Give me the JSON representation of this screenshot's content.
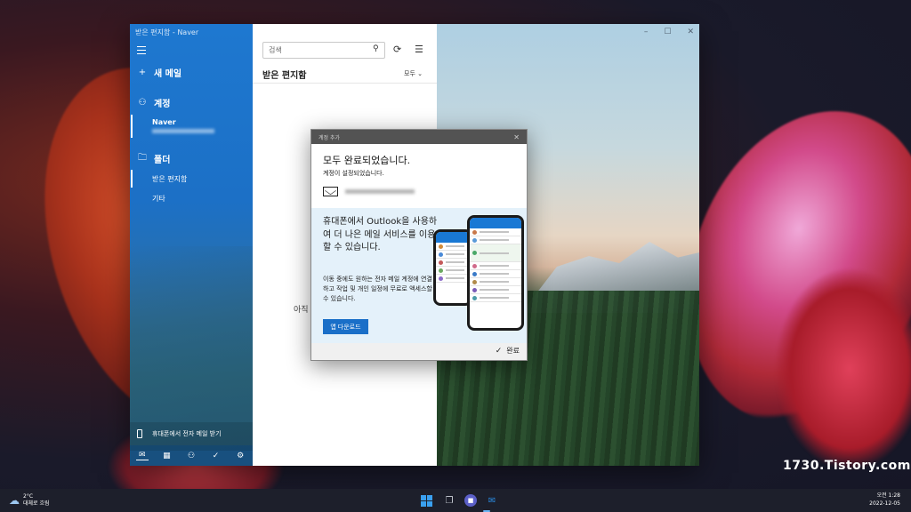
{
  "window": {
    "title": "받은 편지함 - Naver"
  },
  "sidebar": {
    "new_mail": "새 메일",
    "accounts_label": "계정",
    "account_name": "Naver",
    "folders_label": "폴더",
    "folders": [
      {
        "label": "받은 편지함"
      },
      {
        "label": "기타"
      }
    ],
    "phone_label": "휴대폰에서 전자 메일 받기"
  },
  "list": {
    "search_placeholder": "검색",
    "title": "받은 편지함",
    "filter": "모두",
    "empty_text": "아직"
  },
  "dialog": {
    "title": "계정 추가",
    "heading": "모두 완료되었습니다.",
    "subheading": "계정이 설정되었습니다.",
    "promo_heading": "휴대폰에서 Outlook을 사용하여 더 나은 메일 서비스를 이용할 수 있습니다.",
    "promo_body": "이동 중에도 원하는 전자 메일 계정에 연결하고 작업 및 개인 일정에 무료로 액세스할 수 있습니다.",
    "download_button": "앱 다운로드",
    "done_button": "완료"
  },
  "watermark": "1730.Tistory.com",
  "taskbar": {
    "temperature": "2°C",
    "weather_desc": "대체로 흐림",
    "time": "오전 1:28",
    "date": "2022-12-05"
  },
  "colors": {
    "accent": "#1e78d0",
    "dialog_button": "#1a6fc8"
  }
}
